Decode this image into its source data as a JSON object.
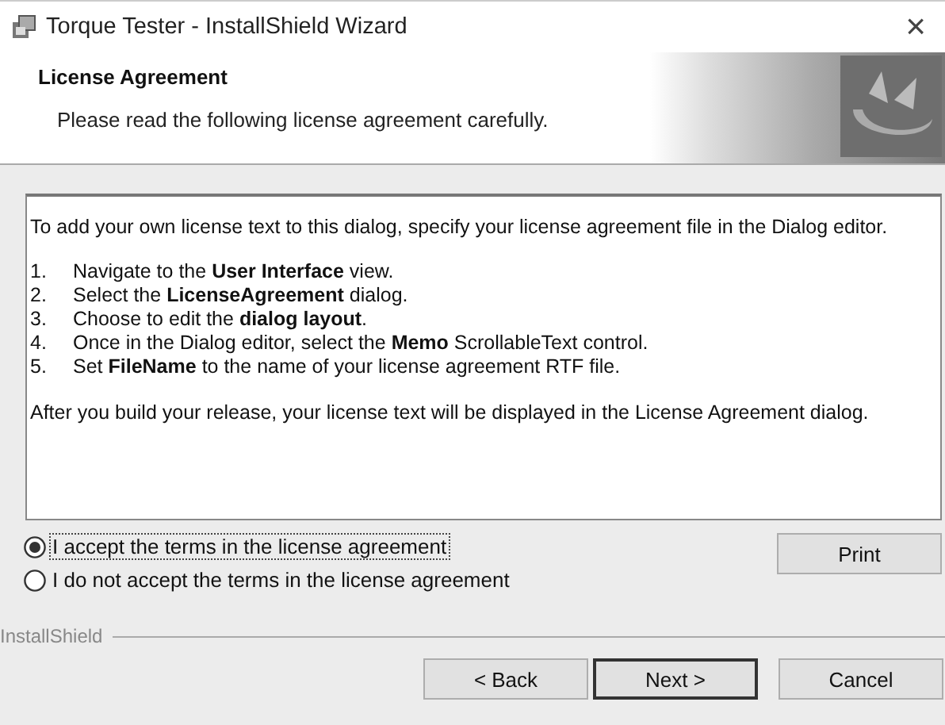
{
  "window": {
    "title": "Torque Tester - InstallShield Wizard",
    "close": "×"
  },
  "header": {
    "title": "License Agreement",
    "subtitle": "Please read the following license agreement carefully."
  },
  "license": {
    "intro": "To add your own license text to this dialog, specify your license agreement file in the Dialog editor.",
    "steps": [
      {
        "number": "1.",
        "text": "Navigate to the **User Interface** view."
      },
      {
        "number": "2.",
        "text": "Select the **LicenseAgreement** dialog."
      },
      {
        "number": "3.",
        "text": "Choose to edit the **dialog layout**."
      },
      {
        "number": "4.",
        "text": "Once in the Dialog editor, select the **Memo** ScrollableText control."
      },
      {
        "number": "5.",
        "text": "Set **FileName** to the name of your license agreement RTF file."
      }
    ],
    "outro": "After you build your release, your license text will be displayed in the License Agreement dialog."
  },
  "radios": [
    {
      "label": "I accept the terms in the license agreement",
      "selected": true
    },
    {
      "label": "I do not accept the terms in the license agreement",
      "selected": false
    }
  ],
  "print_button": {
    "label": "Print"
  },
  "brand": "InstallShield",
  "buttons": [
    {
      "label": "< Back",
      "default": false
    },
    {
      "label": "Next >",
      "default": true
    },
    {
      "label": "Cancel",
      "default": false
    }
  ]
}
